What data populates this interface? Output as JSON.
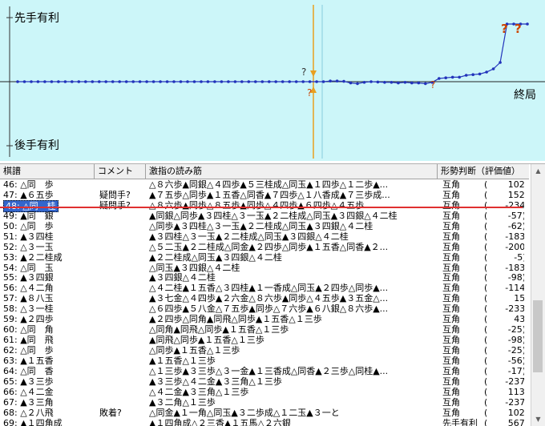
{
  "graph": {
    "top_label": "先手有利",
    "bottom_label": "後手有利",
    "end_label": "終局",
    "question_marks": [
      "?",
      "?",
      "?",
      "?",
      "?"
    ],
    "colors": {
      "background": "#ccf6f9",
      "line": "#2233bb",
      "cursor": "#e8a020",
      "mark": "#cc4400"
    },
    "scores": [
      0,
      0,
      0,
      0,
      0,
      0,
      0,
      0,
      0,
      0,
      0,
      0,
      0,
      0,
      0,
      0,
      0,
      0,
      0,
      0,
      0,
      0,
      0,
      0,
      0,
      0,
      0,
      0,
      0,
      0,
      0,
      0,
      0,
      0,
      0,
      0,
      0,
      0,
      0,
      0,
      0,
      0,
      0,
      0,
      0,
      0,
      10,
      10,
      5,
      -20,
      -30,
      -10,
      0,
      -5,
      -10,
      -10,
      -20,
      -10,
      -20,
      -20,
      -30,
      -10,
      50,
      60,
      70,
      70,
      100,
      110,
      120,
      150,
      200,
      300,
      900,
      900,
      900,
      900
    ]
  },
  "table": {
    "headers": [
      "棋譜",
      "コメント",
      "激指の読み筋",
      "形勢判断（評価値）"
    ],
    "selected_index": 2,
    "rows": [
      {
        "move": "46: △同　歩",
        "comment": "",
        "pv": "△８六歩▲同銀△４四歩▲５三桂成△同玉▲１四歩△１二歩▲...",
        "judge": "互角",
        "score": "(　　 102)"
      },
      {
        "move": "47: ▲６五歩",
        "comment": "疑問手?",
        "pv": "▲７五歩△同歩▲１五香△同香▲７四歩△１八香成▲７三歩成...",
        "judge": "互角",
        "score": "(　　 152)"
      },
      {
        "move": "48: △同　桂",
        "comment": "疑問手?",
        "pv": "△８六歩▲同歩△８五歩▲同歩△４四歩▲６四歩△４五歩",
        "judge": "互角",
        "score": "(　　-234)"
      },
      {
        "move": "49: ▲同　銀",
        "comment": "",
        "pv": "▲同銀△同歩▲３四桂△３一玉▲２二桂成△同玉▲３四銀△４二桂",
        "judge": "互角",
        "score": "(　　 -57)"
      },
      {
        "move": "50: △同　歩",
        "comment": "",
        "pv": "△同歩▲３四桂△３一玉▲２二桂成△同玉▲３四銀△４二桂",
        "judge": "互角",
        "score": "(　　 -62)"
      },
      {
        "move": "51: ▲３四桂",
        "comment": "",
        "pv": "▲３四桂△３一玉▲２二桂成△同玉▲３四銀△４二桂",
        "judge": "互角",
        "score": "(　　-183)"
      },
      {
        "move": "52: △３一玉",
        "comment": "",
        "pv": "△５二玉▲２二桂成△同金▲２四歩△同歩▲１五香△同香▲２...",
        "judge": "互角",
        "score": "(　　-200)"
      },
      {
        "move": "53: ▲２二桂成",
        "comment": "",
        "pv": "▲２二桂成△同玉▲３四銀△４二桂",
        "judge": "互角",
        "score": "(　　　-5)"
      },
      {
        "move": "54: △同　玉",
        "comment": "",
        "pv": "△同玉▲３四銀△４二桂",
        "judge": "互角",
        "score": "(　　-183)"
      },
      {
        "move": "55: ▲３四銀",
        "comment": "",
        "pv": "▲３四銀△４二桂",
        "judge": "互角",
        "score": "(　　 -98)"
      },
      {
        "move": "56: △４二角",
        "comment": "",
        "pv": "△４二桂▲１五香△３四桂▲１一香成△同玉▲２四歩△同歩▲...",
        "judge": "互角",
        "score": "(　　-114)"
      },
      {
        "move": "57: ▲８八玉",
        "comment": "",
        "pv": "▲３七金△４四歩▲２六金△８六歩▲同歩△４五歩▲３五金△...",
        "judge": "互角",
        "score": "(　　　15)"
      },
      {
        "move": "58: △３一桂",
        "comment": "",
        "pv": "△６四歩▲５八金△７五歩▲同歩△７六歩▲６八銀△８六歩▲...",
        "judge": "互角",
        "score": "(　　-233)"
      },
      {
        "move": "59: ▲２四歩",
        "comment": "",
        "pv": "▲２四歩△同角▲同飛△同歩▲１五香△１三歩",
        "judge": "互角",
        "score": "(　　　43)"
      },
      {
        "move": "60: △同　角",
        "comment": "",
        "pv": "△同角▲同飛△同歩▲１五香△１三歩",
        "judge": "互角",
        "score": "(　　 -25)"
      },
      {
        "move": "61: ▲同　飛",
        "comment": "",
        "pv": "▲同飛△同歩▲１五香△１三歩",
        "judge": "互角",
        "score": "(　　 -98)"
      },
      {
        "move": "62: △同　歩",
        "comment": "",
        "pv": "△同歩▲１五香△１三歩",
        "judge": "互角",
        "score": "(　　 -25)"
      },
      {
        "move": "63: ▲１五香",
        "comment": "",
        "pv": "▲１五香△１三歩",
        "judge": "互角",
        "score": "(　　 -56)"
      },
      {
        "move": "64: △同　香",
        "comment": "",
        "pv": "△１三歩▲３三歩△３一金▲１三香成△同香▲２三歩△同桂▲...",
        "judge": "互角",
        "score": "(　　 -17)"
      },
      {
        "move": "65: ▲３三歩",
        "comment": "",
        "pv": "▲３三歩△４二金▲３三角△１三歩",
        "judge": "互角",
        "score": "(　　-237)"
      },
      {
        "move": "66: △４二金",
        "comment": "",
        "pv": "△４二金▲３三角△１三歩",
        "judge": "互角",
        "score": "(　　 113)"
      },
      {
        "move": "67: ▲３三角",
        "comment": "",
        "pv": "▲３二角△１三歩",
        "judge": "互角",
        "score": "(　　-237)"
      },
      {
        "move": "68: △２八飛",
        "comment": "敗着?",
        "pv": "△同金▲１一角△同玉▲３二歩成△１二玉▲３一と",
        "judge": "互角",
        "score": "(　　 102)"
      },
      {
        "move": "69: ▲１四角成",
        "comment": "",
        "pv": "▲１四角成△２三香▲１五馬△２六銀",
        "judge": "先手有利",
        "score": "(　　 567)"
      }
    ]
  }
}
